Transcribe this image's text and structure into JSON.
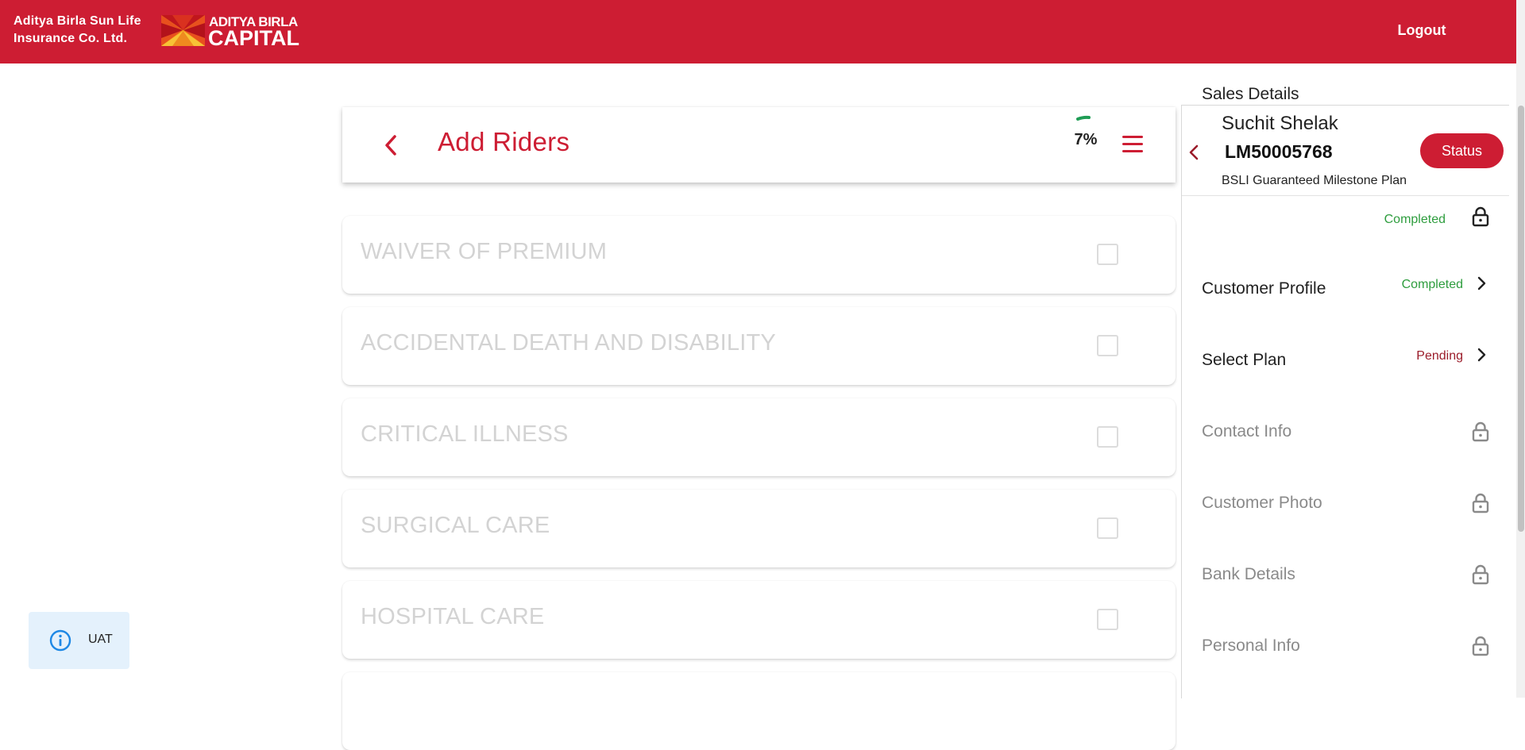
{
  "header": {
    "company_line1": "Aditya Birla Sun Life",
    "company_line2": "Insurance Co. Ltd.",
    "logo_line1": "ADITYA BIRLA",
    "logo_line2": "CAPITAL",
    "logout_label": "Logout",
    "brand_color": "#cd1d33"
  },
  "title_card": {
    "title": "Add Riders",
    "progress_text": "7%",
    "progress_value": 0.07,
    "back_icon": "chevron-left-icon",
    "menu_icon": "hamburger-menu-icon"
  },
  "riders": [
    {
      "label": "WAIVER OF PREMIUM",
      "checked": false
    },
    {
      "label": "ACCIDENTAL DEATH AND DISABILITY",
      "checked": false
    },
    {
      "label": "CRITICAL ILLNESS",
      "checked": false
    },
    {
      "label": "SURGICAL CARE",
      "checked": false
    },
    {
      "label": "HOSPITAL CARE",
      "checked": false
    },
    {
      "label": "",
      "checked": false
    }
  ],
  "uat_badge": {
    "label": "UAT",
    "icon": "info-icon"
  },
  "side_panel": {
    "customer_name": "Suchit Shelak",
    "lead_id": "LM50005768",
    "plan_name": "BSLI Guaranteed Milestone Plan",
    "status_button": "Status",
    "steps": [
      {
        "label": "Sales Details",
        "status": "Completed",
        "status_color": "#2e9d3e",
        "icon": "lock-icon",
        "enabled": true
      },
      {
        "label": "Customer Profile",
        "status": "Completed",
        "status_color": "#2e9d3e",
        "icon": "chevron-right-icon",
        "enabled": true
      },
      {
        "label": "Select Plan",
        "status": "Pending",
        "status_color": "#9b1c2a",
        "icon": "chevron-right-icon",
        "enabled": true
      },
      {
        "label": "Contact Info",
        "status": "",
        "icon": "lock-icon",
        "enabled": false
      },
      {
        "label": "Customer Photo",
        "status": "",
        "icon": "lock-icon",
        "enabled": false
      },
      {
        "label": "Bank Details",
        "status": "",
        "icon": "lock-icon",
        "enabled": false
      },
      {
        "label": "Personal Info",
        "status": "",
        "icon": "lock-icon",
        "enabled": false
      }
    ]
  }
}
